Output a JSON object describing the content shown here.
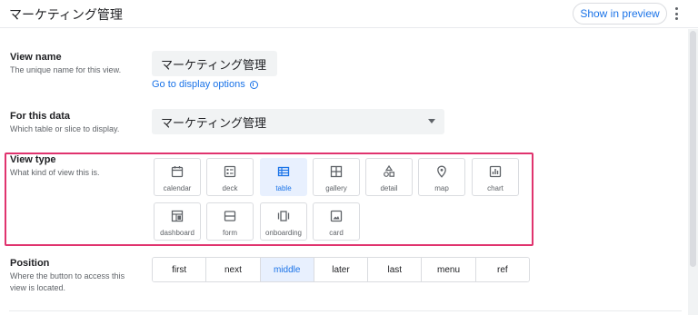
{
  "header": {
    "title": "マーケティング管理",
    "preview_label": "Show in preview"
  },
  "view_name": {
    "title": "View name",
    "desc": "The unique name for this view.",
    "value": "マーケティング管理",
    "link": "Go to display options"
  },
  "for_data": {
    "title": "For this data",
    "desc": "Which table or slice to display.",
    "value": "マーケティング管理"
  },
  "view_type": {
    "title": "View type",
    "desc": "What kind of view this is.",
    "selected": "table",
    "options": [
      {
        "label": "calendar",
        "icon": "calendar-icon"
      },
      {
        "label": "deck",
        "icon": "deck-icon"
      },
      {
        "label": "table",
        "icon": "table-icon"
      },
      {
        "label": "gallery",
        "icon": "gallery-icon"
      },
      {
        "label": "detail",
        "icon": "detail-icon"
      },
      {
        "label": "map",
        "icon": "map-pin-icon"
      },
      {
        "label": "chart",
        "icon": "chart-icon"
      },
      {
        "label": "dashboard",
        "icon": "dashboard-icon"
      },
      {
        "label": "form",
        "icon": "form-icon"
      },
      {
        "label": "onboarding",
        "icon": "onboarding-icon"
      },
      {
        "label": "card",
        "icon": "card-icon"
      }
    ]
  },
  "position": {
    "title": "Position",
    "desc_line1": "Where the button to access this",
    "desc_line2": "view is located.",
    "selected": "middle",
    "options": [
      "first",
      "next",
      "middle",
      "later",
      "last",
      "menu",
      "ref"
    ]
  },
  "colors": {
    "accent": "#1a73e8",
    "selected_bg": "#e8f0fe",
    "highlight": "#e0336e",
    "icon": "#5f6368"
  }
}
